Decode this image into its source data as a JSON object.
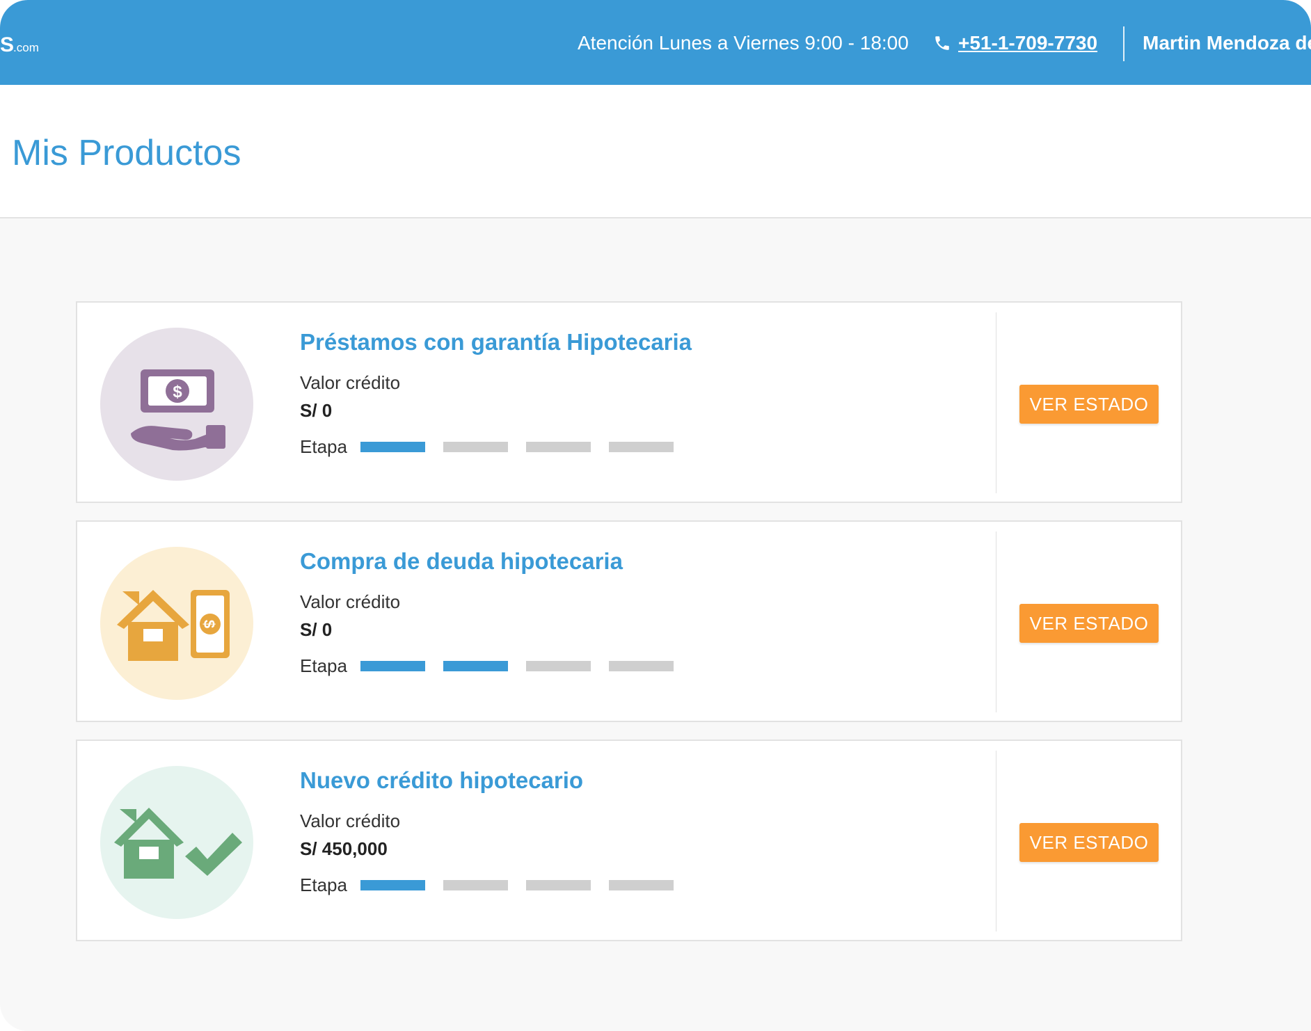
{
  "topbar": {
    "logo_fragment": "S",
    "logo_suffix": ".com",
    "hours": "Atención Lunes a Viernes 9:00 - 18:00",
    "phone": "+51-1-709-7730",
    "user_name": "Martin Mendoza de"
  },
  "page": {
    "title": "Mis Productos"
  },
  "products": [
    {
      "title": "Préstamos con garantía Hipotecaria",
      "value_label": "Valor crédito",
      "value_amount": "S/ 0",
      "stage_label": "Etapa",
      "stage_progress": 1,
      "stage_total": 4,
      "button_label": "VER ESTADO",
      "icon": "money-hand-icon",
      "circle_color": "#e7e1e9",
      "icon_color": "#8f6f97"
    },
    {
      "title": "Compra de deuda hipotecaria",
      "value_label": "Valor crédito",
      "value_amount": "S/ 0",
      "stage_label": "Etapa",
      "stage_progress": 2,
      "stage_total": 4,
      "button_label": "VER ESTADO",
      "icon": "house-money-icon",
      "circle_color": "#fcefd4",
      "icon_color": "#e7a63e"
    },
    {
      "title": "Nuevo crédito hipotecario",
      "value_label": "Valor crédito",
      "value_amount": "S/ 450,000",
      "stage_label": "Etapa",
      "stage_progress": 1,
      "stage_total": 4,
      "button_label": "VER ESTADO",
      "icon": "house-check-icon",
      "circle_color": "#e6f4ef",
      "icon_color": "#6aaa7a"
    }
  ],
  "colors": {
    "brand_blue": "#3a9ad6",
    "button_orange": "#fa9a33",
    "stage_inactive": "#cfcfcf"
  }
}
